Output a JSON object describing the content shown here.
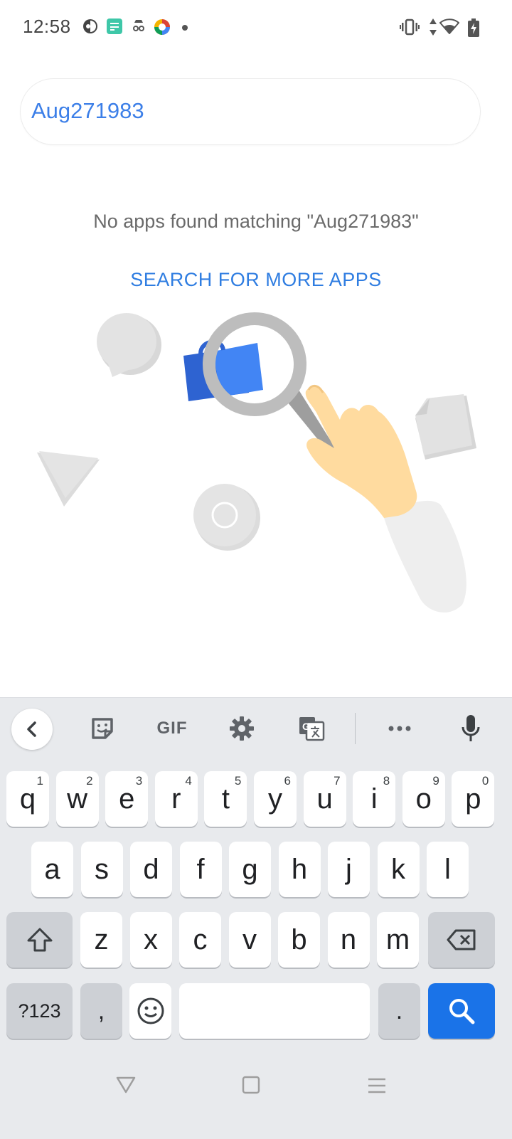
{
  "status_bar": {
    "time": "12:58"
  },
  "search": {
    "value": "Aug271983"
  },
  "results": {
    "empty_message": "No apps found matching \"Aug271983\"",
    "more_apps_link": "SEARCH FOR MORE APPS"
  },
  "keyboard": {
    "toolbar": {
      "gif_label": "GIF"
    },
    "rows": [
      [
        {
          "label": "q",
          "hint": "1"
        },
        {
          "label": "w",
          "hint": "2"
        },
        {
          "label": "e",
          "hint": "3"
        },
        {
          "label": "r",
          "hint": "4"
        },
        {
          "label": "t",
          "hint": "5"
        },
        {
          "label": "y",
          "hint": "6"
        },
        {
          "label": "u",
          "hint": "7"
        },
        {
          "label": "i",
          "hint": "8"
        },
        {
          "label": "o",
          "hint": "9"
        },
        {
          "label": "p",
          "hint": "0"
        }
      ],
      [
        {
          "label": "a"
        },
        {
          "label": "s"
        },
        {
          "label": "d"
        },
        {
          "label": "f"
        },
        {
          "label": "g"
        },
        {
          "label": "h"
        },
        {
          "label": "j"
        },
        {
          "label": "k"
        },
        {
          "label": "l"
        }
      ],
      [
        {
          "label": "z"
        },
        {
          "label": "x"
        },
        {
          "label": "c"
        },
        {
          "label": "v"
        },
        {
          "label": "b"
        },
        {
          "label": "n"
        },
        {
          "label": "m"
        }
      ]
    ],
    "symbols_label": "?123",
    "comma_label": ",",
    "period_label": "."
  },
  "colors": {
    "accent": "#1a73e8",
    "link": "#2f7de1"
  }
}
